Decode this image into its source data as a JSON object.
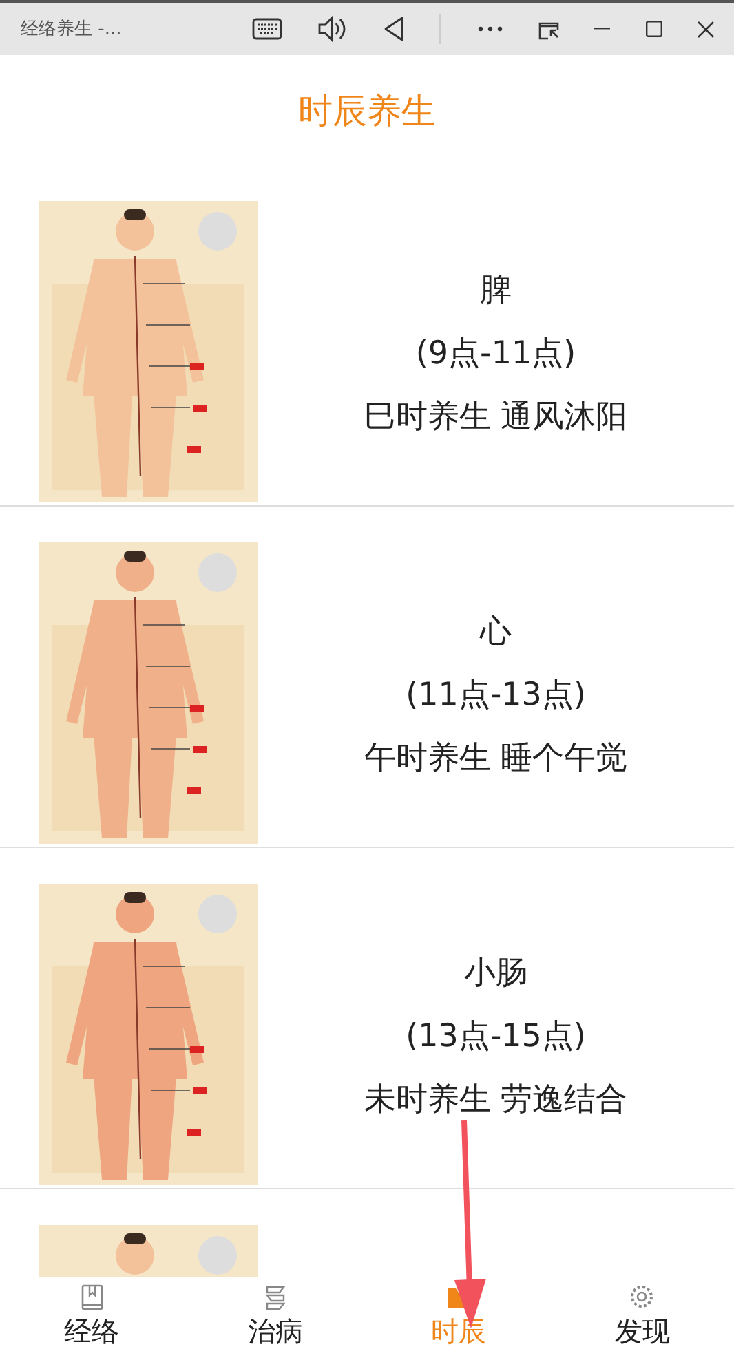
{
  "window": {
    "title": "经络养生 -..."
  },
  "header": {
    "title": "时辰养生"
  },
  "entries": [
    {
      "kind": "full",
      "organ": "脾",
      "hours": "(9点-11点)",
      "advice": "巳时养生 通风沐阳"
    },
    {
      "kind": "full",
      "organ": "心",
      "hours": "(11点-13点)",
      "advice": "午时养生 睡个午觉"
    },
    {
      "kind": "full",
      "organ": "小肠",
      "hours": "(13点-15点)",
      "advice": "未时养生 劳逸结合"
    },
    {
      "kind": "partial"
    }
  ],
  "tabs": [
    {
      "label": "经络",
      "kind": "book",
      "selected": false
    },
    {
      "label": "治病",
      "kind": "ribbon",
      "selected": false
    },
    {
      "label": "时辰",
      "kind": "folder",
      "selected": true
    },
    {
      "label": "发现",
      "kind": "gear",
      "selected": false
    }
  ]
}
